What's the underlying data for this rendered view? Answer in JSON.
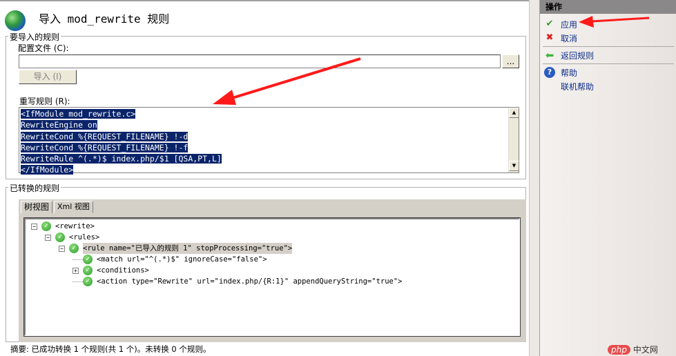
{
  "title": "导入 mod_rewrite 规则",
  "import_group": {
    "legend": "要导入的规则",
    "config_label": "配置文件 (C):",
    "config_value": "",
    "browse_label": "...",
    "import_button": "导入 (I)",
    "rules_label": "重写规则 (R):",
    "rules_lines": [
      "<IfModule mod_rewrite.c>",
      "RewriteEngine on",
      "RewriteCond %{REQUEST_FILENAME} !-d",
      "RewriteCond %{REQUEST_FILENAME} !-f",
      "RewriteRule ^(.*)$ index.php/$1 [QSA,PT,L]",
      "</IfModule>"
    ]
  },
  "converted_group": {
    "legend": "已转换的规则",
    "tabs": [
      "树视图",
      "Xml 视图"
    ],
    "tree": [
      {
        "text": "<rewrite>",
        "toggle": "−"
      },
      {
        "text": "<rules>",
        "toggle": "−"
      },
      {
        "text": "<rule name=\"已导入的规则 1\" stopProcessing=\"true\">",
        "toggle": "−"
      },
      {
        "text": "<match url=\"^(.*)$\" ignoreCase=\"false\">",
        "toggle": ""
      },
      {
        "text": "<conditions>",
        "toggle": "+"
      },
      {
        "text": "<action type=\"Rewrite\" url=\"index.php/{R:1}\" appendQueryString=\"true\">",
        "toggle": ""
      }
    ]
  },
  "summary": "摘要: 已成功转换 1 个规则(共 1 个)。未转换 0 个规则。",
  "actions": {
    "header": "操作",
    "apply": "应用",
    "cancel": "取消",
    "back": "返回规则",
    "help": "帮助",
    "online_help": "联机帮助"
  },
  "watermark": "php 中文网",
  "colors": {
    "selection": "#0a246a",
    "link": "#0b2c8a",
    "arrow": "#ff1a1a"
  }
}
